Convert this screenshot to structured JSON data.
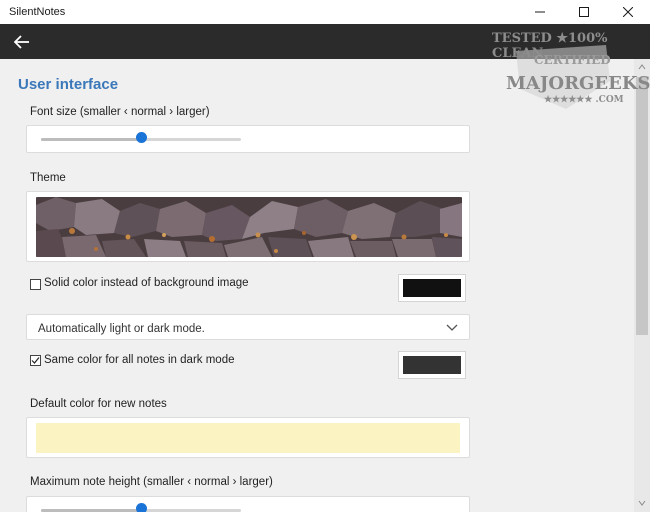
{
  "window": {
    "title": "SilentNotes"
  },
  "window_controls": {
    "minimize": "—",
    "maximize": "☐",
    "close": "✕"
  },
  "nav": {
    "back_icon": "back-arrow-icon"
  },
  "section_title": "User interface",
  "font_size": {
    "label": "Font size (smaller ‹ normal › larger)",
    "value": 0.5
  },
  "theme": {
    "label": "Theme",
    "image": "stone background image"
  },
  "solid_color": {
    "label": "Solid color instead of background image",
    "checked": false,
    "color": "#111111"
  },
  "dark_mode_select": {
    "value": "Automatically light or dark mode."
  },
  "same_color_dark": {
    "label": "Same color for all notes in dark mode",
    "checked": true,
    "color": "#333333"
  },
  "default_note_color": {
    "label": "Default color for new notes",
    "color": "#fbf3c1"
  },
  "max_note_height": {
    "label": "Maximum note height (smaller ‹ normal › larger)",
    "value": 0.5
  },
  "watermark": {
    "line1": "TESTED ★100% CLEAN",
    "line2": "CERTIFIED",
    "line3": "MAJORGEEKS",
    "line4": "★★★★★★ .COM"
  },
  "colors": {
    "accent": "#1a73d6",
    "section_title": "#3b78b9",
    "nav_bar": "#2b2b2b"
  }
}
